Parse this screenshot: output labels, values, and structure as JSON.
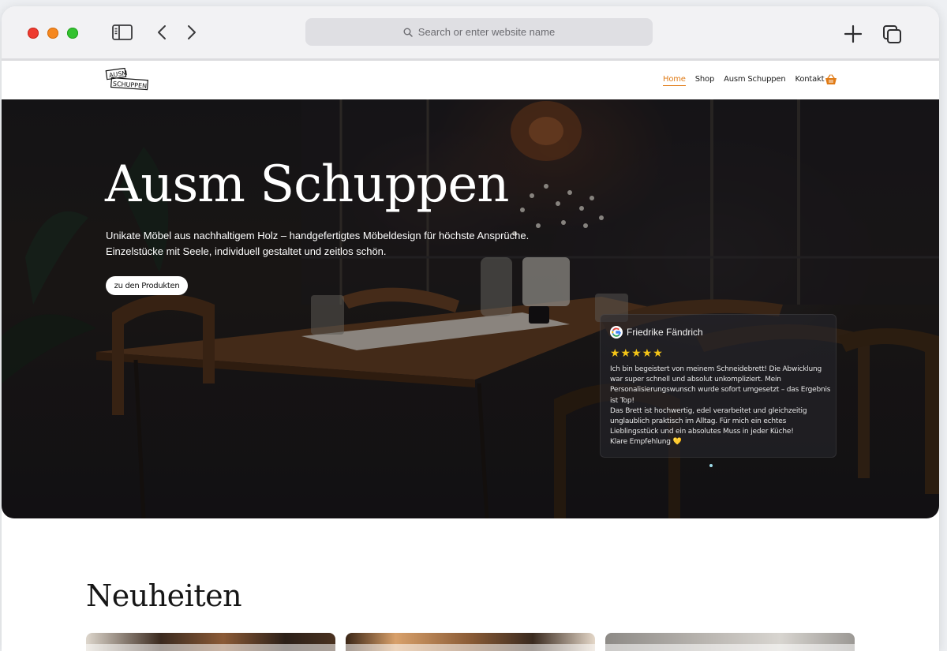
{
  "browser": {
    "address_placeholder": "Search or enter website name"
  },
  "site": {
    "logo_text": "AUSM SCHUPPEN",
    "nav": [
      {
        "label": "Home",
        "active": true
      },
      {
        "label": "Shop",
        "active": false
      },
      {
        "label": "Ausm Schuppen",
        "active": false
      },
      {
        "label": "Kontakt",
        "active": false
      }
    ],
    "accent_color": "#e07b16"
  },
  "hero": {
    "title": "Ausm Schuppen",
    "subtitle_line1": "Unikate Möbel aus nachhaltigem Holz – handgefertigtes Möbeldesign für höchste Ansprüche.",
    "subtitle_line2": "Einzelstücke mit Seele, individuell gestaltet und zeitlos schön.",
    "button_label": "zu den Produkten"
  },
  "review": {
    "source_icon": "google-icon",
    "name": "Friedrike Fändrich",
    "stars": "★★★★★",
    "rating": 5,
    "paragraph1": "Ich bin begeistert von meinem Schneidebrett! Die Abwicklung war super schnell und absolut unkompliziert. Mein Personalisierungswunsch wurde sofort umgesetzt – das Ergebnis ist Top!",
    "paragraph2": "Das Brett ist hochwertig, edel verarbeitet und gleichzeitig unglaublich praktisch im Alltag. Für mich ein echtes Lieblingsstück und ein absolutes Muss in jeder Küche!",
    "paragraph3": "Klare Empfehlung 💛"
  },
  "section": {
    "title": "Neuheiten"
  }
}
